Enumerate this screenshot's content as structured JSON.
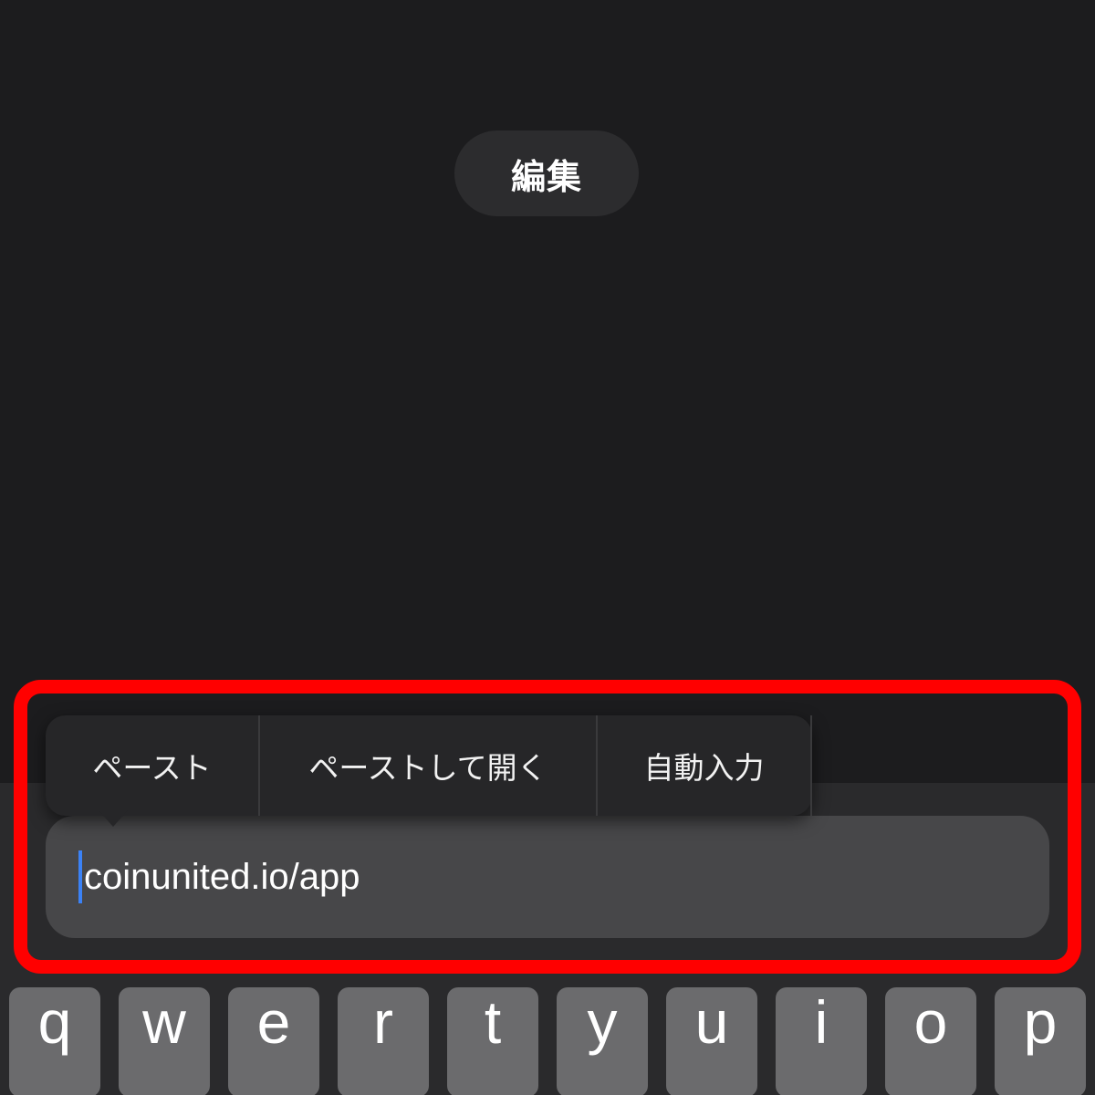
{
  "header": {
    "edit_button_label": "編集"
  },
  "context_menu": {
    "items": [
      {
        "label": "ペースト"
      },
      {
        "label": "ペーストして開く"
      },
      {
        "label": "自動入力"
      }
    ]
  },
  "url_field": {
    "value": "coinunited.io/app"
  },
  "keyboard": {
    "row1": [
      "q",
      "w",
      "e",
      "r",
      "t",
      "y",
      "u",
      "i",
      "o",
      "p"
    ]
  },
  "colors": {
    "background": "#1c1c1e",
    "highlight": "#ff0000",
    "caret": "#3b82f6"
  }
}
